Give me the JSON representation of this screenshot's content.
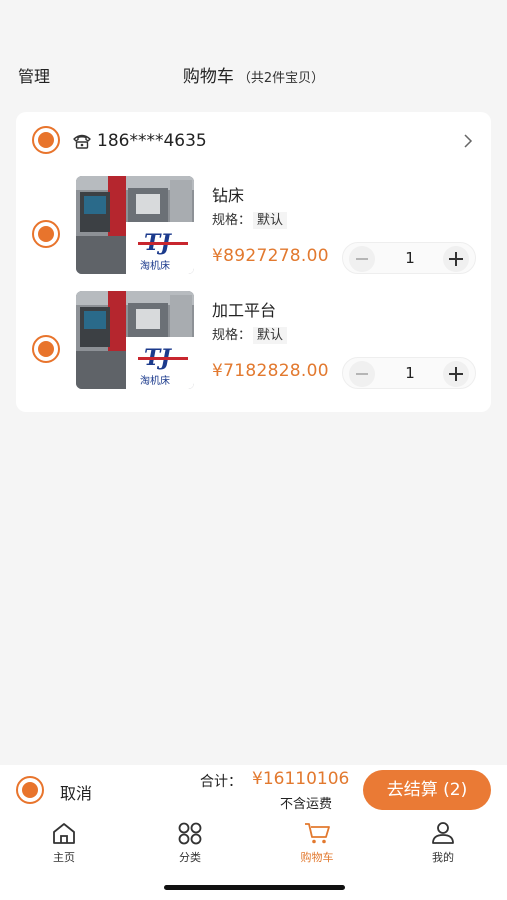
{
  "header": {
    "manage": "管理",
    "title": "购物车",
    "subtitle": "（共2件宝贝）"
  },
  "shop": {
    "icon": "phone-icon",
    "name": "186****4635"
  },
  "items": [
    {
      "name": "钻床",
      "spec_label": "规格：",
      "spec_value": "默认",
      "price": "¥8927278.00",
      "qty": "1",
      "logo_text": "淘机床"
    },
    {
      "name": "加工平台",
      "spec_label": "规格：",
      "spec_value": "默认",
      "price": "¥7182828.00",
      "qty": "1",
      "logo_text": "淘机床"
    }
  ],
  "bottom": {
    "cancel": "取消",
    "total_label": "合计：",
    "total_value": "¥16110106",
    "shipping": "不含运费",
    "checkout": "去结算 (2)"
  },
  "tabs": [
    {
      "label": "主页",
      "icon": "home-icon"
    },
    {
      "label": "分类",
      "icon": "category-icon"
    },
    {
      "label": "购物车",
      "icon": "cart-icon",
      "active": true
    },
    {
      "label": "我的",
      "icon": "user-icon"
    }
  ],
  "colors": {
    "accent": "#e8742c",
    "price": "#e2792f",
    "background": "#f5f5f5"
  }
}
